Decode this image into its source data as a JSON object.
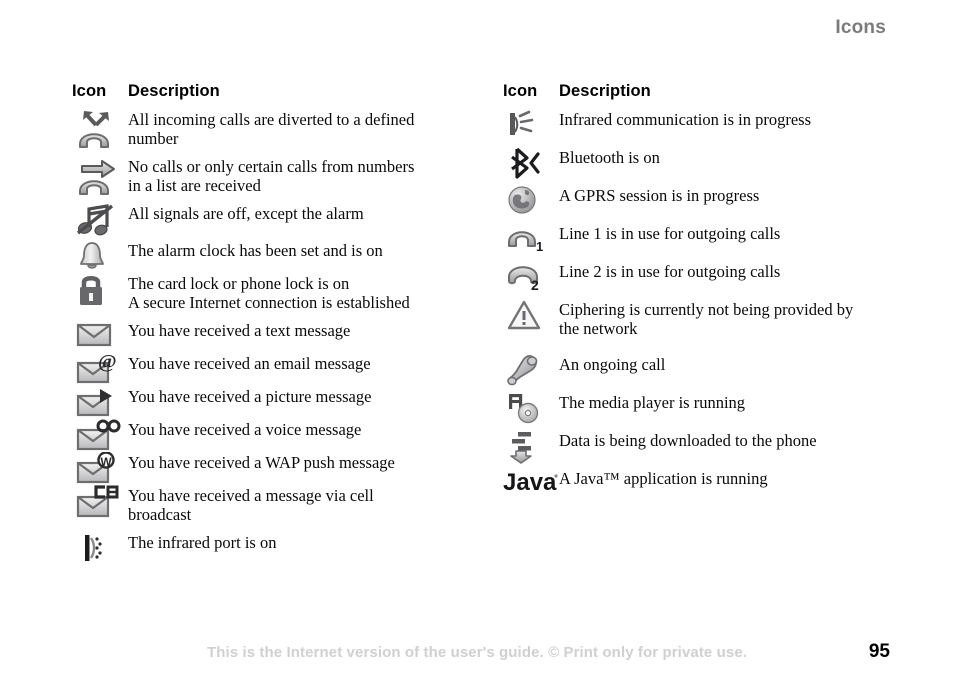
{
  "header": {
    "title": "Icons"
  },
  "columns": [
    {
      "id": "left",
      "head_icon": "Icon",
      "head_desc": "Description",
      "rows": [
        {
          "icon": "call-divert-all-icon",
          "line1": "All incoming calls are diverted to a defined",
          "line2": "number"
        },
        {
          "icon": "call-restrict-icon",
          "line1": "No calls or only certain calls from numbers",
          "line2": "in a list are received"
        },
        {
          "icon": "silent-mode-icon",
          "line1": "All signals are off, except the alarm",
          "line2": ""
        },
        {
          "icon": "alarm-bell-icon",
          "line1": "The alarm clock has been set and is on",
          "line2": ""
        },
        {
          "icon": "lock-icon",
          "line1": "The card lock or phone lock is on",
          "line2": "A secure Internet connection is established"
        },
        {
          "icon": "envelope-text-icon",
          "line1": "You have received a text message",
          "line2": ""
        },
        {
          "icon": "envelope-email-icon",
          "line1": "You have received an email message",
          "line2": ""
        },
        {
          "icon": "envelope-picture-icon",
          "line1": "You have received a picture message",
          "line2": ""
        },
        {
          "icon": "envelope-voice-icon",
          "line1": "You have received a voice message",
          "line2": ""
        },
        {
          "icon": "envelope-wap-push-icon",
          "line1": "You have received a WAP push message",
          "line2": ""
        },
        {
          "icon": "envelope-cell-broadcast-icon",
          "line1": "You have received a message via cell",
          "line2": "broadcast"
        },
        {
          "icon": "infrared-port-icon",
          "line1": "The infrared port is on",
          "line2": ""
        }
      ]
    },
    {
      "id": "right",
      "head_icon": "Icon",
      "head_desc": "Description",
      "rows": [
        {
          "icon": "infrared-active-icon",
          "line1": "Infrared communication is in progress",
          "line2": ""
        },
        {
          "icon": "bluetooth-icon",
          "line1": "Bluetooth is on",
          "line2": ""
        },
        {
          "icon": "gprs-globe-icon",
          "line1": "A GPRS session is in progress",
          "line2": ""
        },
        {
          "icon": "line-1-icon",
          "line1": "Line 1 is in use for outgoing calls",
          "line2": ""
        },
        {
          "icon": "line-2-icon",
          "line1": "Line 2 is in use for outgoing calls",
          "line2": ""
        },
        {
          "icon": "warning-triangle-icon",
          "line1": "Ciphering is currently not being provided by",
          "line2": "the network"
        },
        {
          "icon": "ongoing-call-icon",
          "line1": "An ongoing call",
          "line2": ""
        },
        {
          "icon": "media-player-icon",
          "line1": "The media player is running",
          "line2": ""
        },
        {
          "icon": "download-data-icon",
          "line1": "Data is being downloaded to the phone",
          "line2": ""
        },
        {
          "icon": "java-logo-icon",
          "line1": "A Java™ application is running",
          "line2": ""
        }
      ]
    }
  ],
  "footer": {
    "note": "This is the Internet version of the user's guide. © Print only for private use.",
    "page_number": "95"
  },
  "colors": {
    "header_gray": "#7b7b7b",
    "footer_gray": "#d0d0d0",
    "icon_dark": "#58585a",
    "icon_light": "#d8d8d8",
    "text": "#0a0a0a"
  }
}
